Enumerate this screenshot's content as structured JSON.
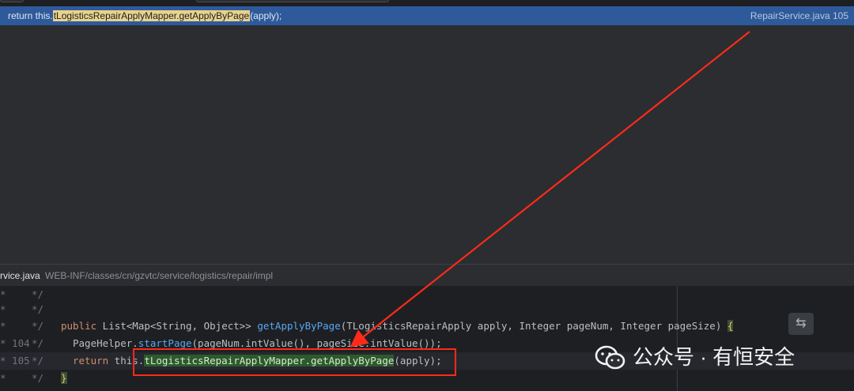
{
  "search_result": {
    "prefix": "return this.",
    "highlight": "tLogisticsRepairApplyMapper.getApplyByPage",
    "suffix": "(apply);",
    "location": "RepairService.java 105"
  },
  "preview_header": {
    "file_name": "rvice.java",
    "file_path": "WEB-INF/classes/cn/gzvtc/service/logistics/repair/impl"
  },
  "editor": {
    "lines": [
      {
        "gutter1": "*",
        "gutter2": "*/",
        "code": ""
      },
      {
        "gutter1": "*",
        "gutter2": "*/",
        "code": ""
      },
      {
        "gutter1": "*",
        "gutter2": "*/",
        "kw1": "public",
        "code": " List<Map<String, Object>> ",
        "fn": "getApplyByPage",
        "code2": "(TLogisticsRepairApply apply, Integer pageNum, Integer pageSize) ",
        "brace": "{"
      },
      {
        "gutter1": "* 104",
        "gutter2": "*/",
        "code": "PageHelper.",
        "fn": "startPage",
        "code2": "(pageNum.intValue(), pageSize.intValue());"
      },
      {
        "gutter1": "* 105",
        "gutter2": "*/",
        "kw1": "return",
        "code": " this.",
        "green": "tLogisticsRepairApplyMapper.getApplyByPage",
        "code2": "(apply);"
      },
      {
        "gutter1": "*",
        "gutter2": "*/",
        "brace": "}"
      }
    ]
  },
  "watermark": {
    "text": "公众号 · 有恒安全"
  },
  "icons": {
    "soft_wrap": "soft-wrap-icon",
    "logo": "wechat-logo-icon"
  },
  "colors": {
    "selected_row": "#2e5a9b",
    "highlight": "#e8d28c",
    "annotation_red": "#ff2a1a"
  }
}
